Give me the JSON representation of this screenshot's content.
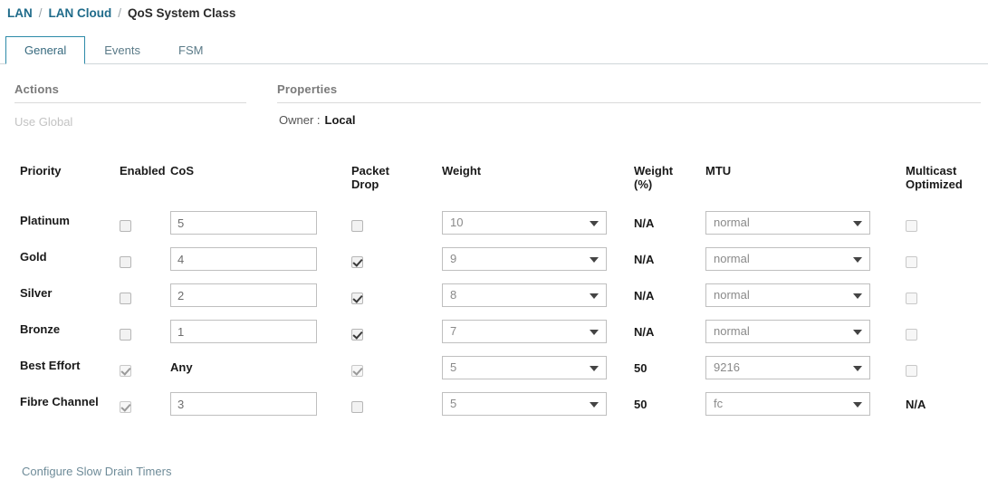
{
  "breadcrumb": {
    "items": [
      {
        "label": "LAN",
        "current": false
      },
      {
        "label": "LAN Cloud",
        "current": false
      },
      {
        "label": "QoS System Class",
        "current": true
      }
    ],
    "separator": "/"
  },
  "tabs": [
    {
      "label": "General",
      "active": true
    },
    {
      "label": "Events",
      "active": false
    },
    {
      "label": "FSM",
      "active": false
    }
  ],
  "actions": {
    "title": "Actions",
    "use_global_label": "Use Global"
  },
  "properties": {
    "title": "Properties",
    "owner_label": "Owner :",
    "owner_value": "Local"
  },
  "table": {
    "headers": {
      "priority": "Priority",
      "enabled": "Enabled",
      "cos": "CoS",
      "packet_drop": "Packet Drop",
      "weight": "Weight",
      "weight_pct": "Weight (%)",
      "mtu": "MTU",
      "multicast_optimized": "Multicast Optimized"
    },
    "rows": [
      {
        "priority": "Platinum",
        "enabled": false,
        "enabled_disabled": false,
        "cos_type": "input",
        "cos": "5",
        "packet_drop": false,
        "packet_drop_disabled": false,
        "weight": "10",
        "weight_pct": "N/A",
        "mtu": "normal",
        "multicast_type": "checkbox",
        "multicast_optimized": false,
        "multicast_text": ""
      },
      {
        "priority": "Gold",
        "enabled": false,
        "enabled_disabled": false,
        "cos_type": "input",
        "cos": "4",
        "packet_drop": true,
        "packet_drop_disabled": false,
        "weight": "9",
        "weight_pct": "N/A",
        "mtu": "normal",
        "multicast_type": "checkbox",
        "multicast_optimized": false,
        "multicast_text": ""
      },
      {
        "priority": "Silver",
        "enabled": false,
        "enabled_disabled": false,
        "cos_type": "input",
        "cos": "2",
        "packet_drop": true,
        "packet_drop_disabled": false,
        "weight": "8",
        "weight_pct": "N/A",
        "mtu": "normal",
        "multicast_type": "checkbox",
        "multicast_optimized": false,
        "multicast_text": ""
      },
      {
        "priority": "Bronze",
        "enabled": false,
        "enabled_disabled": false,
        "cos_type": "input",
        "cos": "1",
        "packet_drop": true,
        "packet_drop_disabled": false,
        "weight": "7",
        "weight_pct": "N/A",
        "mtu": "normal",
        "multicast_type": "checkbox",
        "multicast_optimized": false,
        "multicast_text": ""
      },
      {
        "priority": "Best Effort",
        "enabled": true,
        "enabled_disabled": true,
        "cos_type": "text",
        "cos": "Any",
        "packet_drop": true,
        "packet_drop_disabled": true,
        "weight": "5",
        "weight_pct": "50",
        "mtu": "9216",
        "multicast_type": "checkbox",
        "multicast_optimized": false,
        "multicast_text": ""
      },
      {
        "priority": "Fibre Channel",
        "enabled": true,
        "enabled_disabled": true,
        "cos_type": "input",
        "cos": "3",
        "packet_drop": false,
        "packet_drop_disabled": false,
        "weight": "5",
        "weight_pct": "50",
        "mtu": "fc",
        "multicast_type": "text",
        "multicast_optimized": false,
        "multicast_text": "N/A"
      }
    ]
  },
  "footer": {
    "configure_slow_drain_timers": "Configure Slow Drain Timers"
  },
  "colors": {
    "link": "#1f6b8a",
    "tab_active_border": "#2d8aa8",
    "footer_link": "#6f8c99"
  }
}
